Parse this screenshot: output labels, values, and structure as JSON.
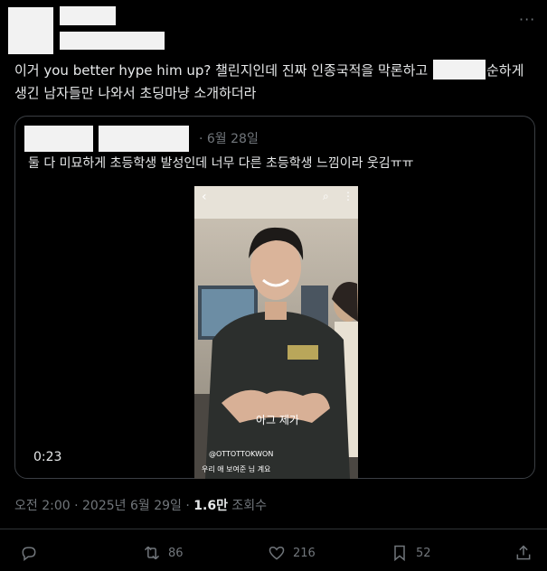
{
  "tweet": {
    "text_before": "이거 you better hype him up? 챌린지인데 진짜 인종국적을 막론하고 ",
    "text_after": "순하게 생긴 남자들만 나와서 초딩마냥 소개하더라",
    "more_icon": "more-horizontal-icon",
    "time": "오전 2:00",
    "date": "2025년 6월 29일",
    "views_count": "1.6만",
    "views_label": "조회수"
  },
  "quote": {
    "date": "· 6월 28일",
    "text": "둘 다 미묘하게 초등학생 발성인데 너무 다른 초등학생 느낌이라 웃김ㅠㅠ",
    "video": {
      "duration": "0:23",
      "caption": "아그 제가",
      "account": "@OTTOTTOKWON",
      "subtext": "우리 애 보여준 님 계요"
    }
  },
  "actions": {
    "reply_icon": "reply-icon",
    "retweet_icon": "retweet-icon",
    "retweet_count": "86",
    "like_icon": "heart-icon",
    "like_count": "216",
    "bookmark_icon": "bookmark-icon",
    "bookmark_count": "52",
    "share_icon": "share-icon"
  },
  "colors": {
    "background": "#000000",
    "text": "#e7e9ea",
    "muted": "#71767b",
    "border": "#3b3f44"
  }
}
